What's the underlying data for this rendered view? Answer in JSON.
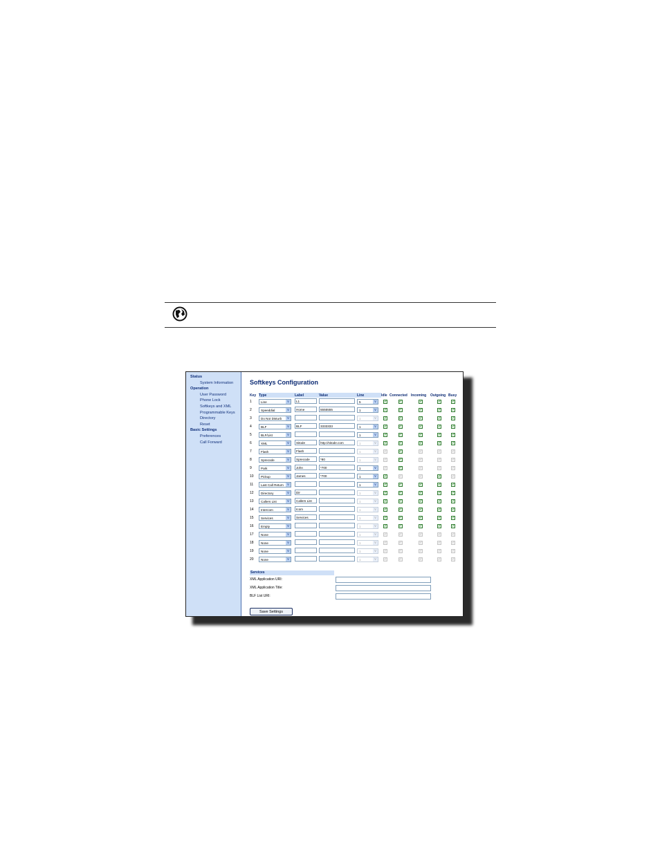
{
  "nav": {
    "status": "Status",
    "system_information": "System Information",
    "operation": "Operation",
    "user_password": "User Password",
    "phone_lock": "Phone Lock",
    "softkeys_xml": "Softkeys and XML",
    "programmable_keys": "Programmable Keys",
    "directory": "Directory",
    "reset": "Reset",
    "basic_settings": "Basic Settings",
    "preferences": "Preferences",
    "call_forward": "Call Forward"
  },
  "page_title": "Softkeys Configuration",
  "table": {
    "headers": {
      "key": "Key",
      "type": "Type",
      "label": "Label",
      "value": "Value",
      "line": "Line",
      "idle": "Idle",
      "connected": "Connected",
      "incoming": "Incoming",
      "outgoing": "Outgoing",
      "busy": "Busy"
    },
    "rows": [
      {
        "key": "1",
        "type": "Line",
        "label": "L1",
        "value": "",
        "line": "5",
        "line_dim": false,
        "states": [
          1,
          1,
          1,
          1,
          1
        ]
      },
      {
        "key": "2",
        "type": "Speeddial",
        "label": "Home",
        "value": "5555555",
        "line": "1",
        "line_dim": false,
        "states": [
          1,
          1,
          1,
          1,
          1
        ]
      },
      {
        "key": "3",
        "type": "Do Not Disturb",
        "label": "",
        "value": "",
        "line": "1",
        "line_dim": true,
        "states": [
          1,
          1,
          1,
          1,
          1
        ]
      },
      {
        "key": "4",
        "type": "BLF",
        "label": "BLF",
        "value": "3333333",
        "line": "1",
        "line_dim": false,
        "states": [
          1,
          1,
          1,
          1,
          1
        ]
      },
      {
        "key": "5",
        "type": "BLF/List",
        "label": "",
        "value": "",
        "line": "1",
        "line_dim": false,
        "states": [
          1,
          1,
          1,
          1,
          1
        ]
      },
      {
        "key": "6",
        "type": "XML",
        "label": "Sitode",
        "value": "http://sitode.com",
        "line": "1",
        "line_dim": true,
        "states": [
          1,
          1,
          1,
          1,
          1
        ]
      },
      {
        "key": "7",
        "type": "Flash",
        "label": "Flash",
        "value": "",
        "line": "1",
        "line_dim": true,
        "states": [
          0,
          1,
          0,
          0,
          0
        ]
      },
      {
        "key": "8",
        "type": "Sprecode",
        "label": "Sprecode",
        "value": "*80",
        "line": "1",
        "line_dim": true,
        "states": [
          0,
          1,
          0,
          0,
          0
        ]
      },
      {
        "key": "9",
        "type": "Park",
        "label": "John",
        "value": "*700",
        "line": "1",
        "line_dim": false,
        "states": [
          0,
          1,
          0,
          0,
          0
        ]
      },
      {
        "key": "10",
        "type": "Pickup",
        "label": "James",
        "value": "*700",
        "line": "1",
        "line_dim": false,
        "states": [
          1,
          0,
          0,
          1,
          0
        ]
      },
      {
        "key": "11",
        "type": "Last Call Return",
        "label": "",
        "value": "",
        "line": "1",
        "line_dim": false,
        "states": [
          1,
          1,
          1,
          1,
          1
        ]
      },
      {
        "key": "12",
        "type": "Directory",
        "label": "Dir",
        "value": "",
        "line": "1",
        "line_dim": true,
        "states": [
          1,
          1,
          1,
          1,
          1
        ]
      },
      {
        "key": "13",
        "type": "Callers List",
        "label": "Callers List",
        "value": "",
        "line": "1",
        "line_dim": true,
        "states": [
          1,
          1,
          1,
          1,
          1
        ]
      },
      {
        "key": "14",
        "type": "Intercom",
        "label": "Icom",
        "value": "",
        "line": "1",
        "line_dim": true,
        "states": [
          1,
          1,
          1,
          1,
          1
        ]
      },
      {
        "key": "15",
        "type": "Services",
        "label": "Services",
        "value": "",
        "line": "1",
        "line_dim": true,
        "states": [
          1,
          1,
          1,
          1,
          1
        ]
      },
      {
        "key": "16",
        "type": "Empty",
        "label": "",
        "value": "",
        "line": "1",
        "line_dim": true,
        "states": [
          1,
          1,
          1,
          1,
          1
        ]
      },
      {
        "key": "17",
        "type": "None",
        "label": "",
        "value": "",
        "line": "1",
        "line_dim": true,
        "states": [
          0,
          0,
          0,
          0,
          0
        ]
      },
      {
        "key": "18",
        "type": "None",
        "label": "",
        "value": "",
        "line": "1",
        "line_dim": true,
        "states": [
          0,
          0,
          0,
          0,
          0
        ]
      },
      {
        "key": "19",
        "type": "None",
        "label": "",
        "value": "",
        "line": "1",
        "line_dim": true,
        "states": [
          0,
          0,
          0,
          0,
          0
        ]
      },
      {
        "key": "20",
        "type": "None",
        "label": "",
        "value": "",
        "line": "1",
        "line_dim": true,
        "states": [
          0,
          0,
          0,
          0,
          0
        ]
      }
    ]
  },
  "services": {
    "header": "Services",
    "xml_uri_label": "XML Application URI:",
    "xml_title_label": "XML Application Title:",
    "blf_uri_label": "BLF List URI:"
  },
  "save_button": "Save Settings",
  "check_glyph": "✓",
  "arrow_glyph": "v"
}
